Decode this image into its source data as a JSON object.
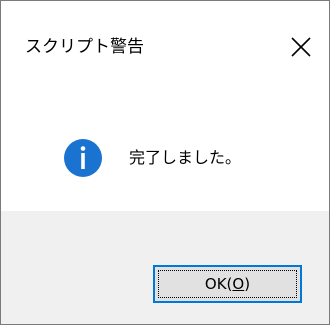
{
  "window": {
    "title": "スクリプト警告",
    "close_glyph": "✕"
  },
  "dialog": {
    "icon": "info-icon",
    "icon_color": "#1a73d0",
    "message": "完了しました。"
  },
  "footer": {
    "ok_label": "OK(O)",
    "accent": "#0078d7"
  }
}
